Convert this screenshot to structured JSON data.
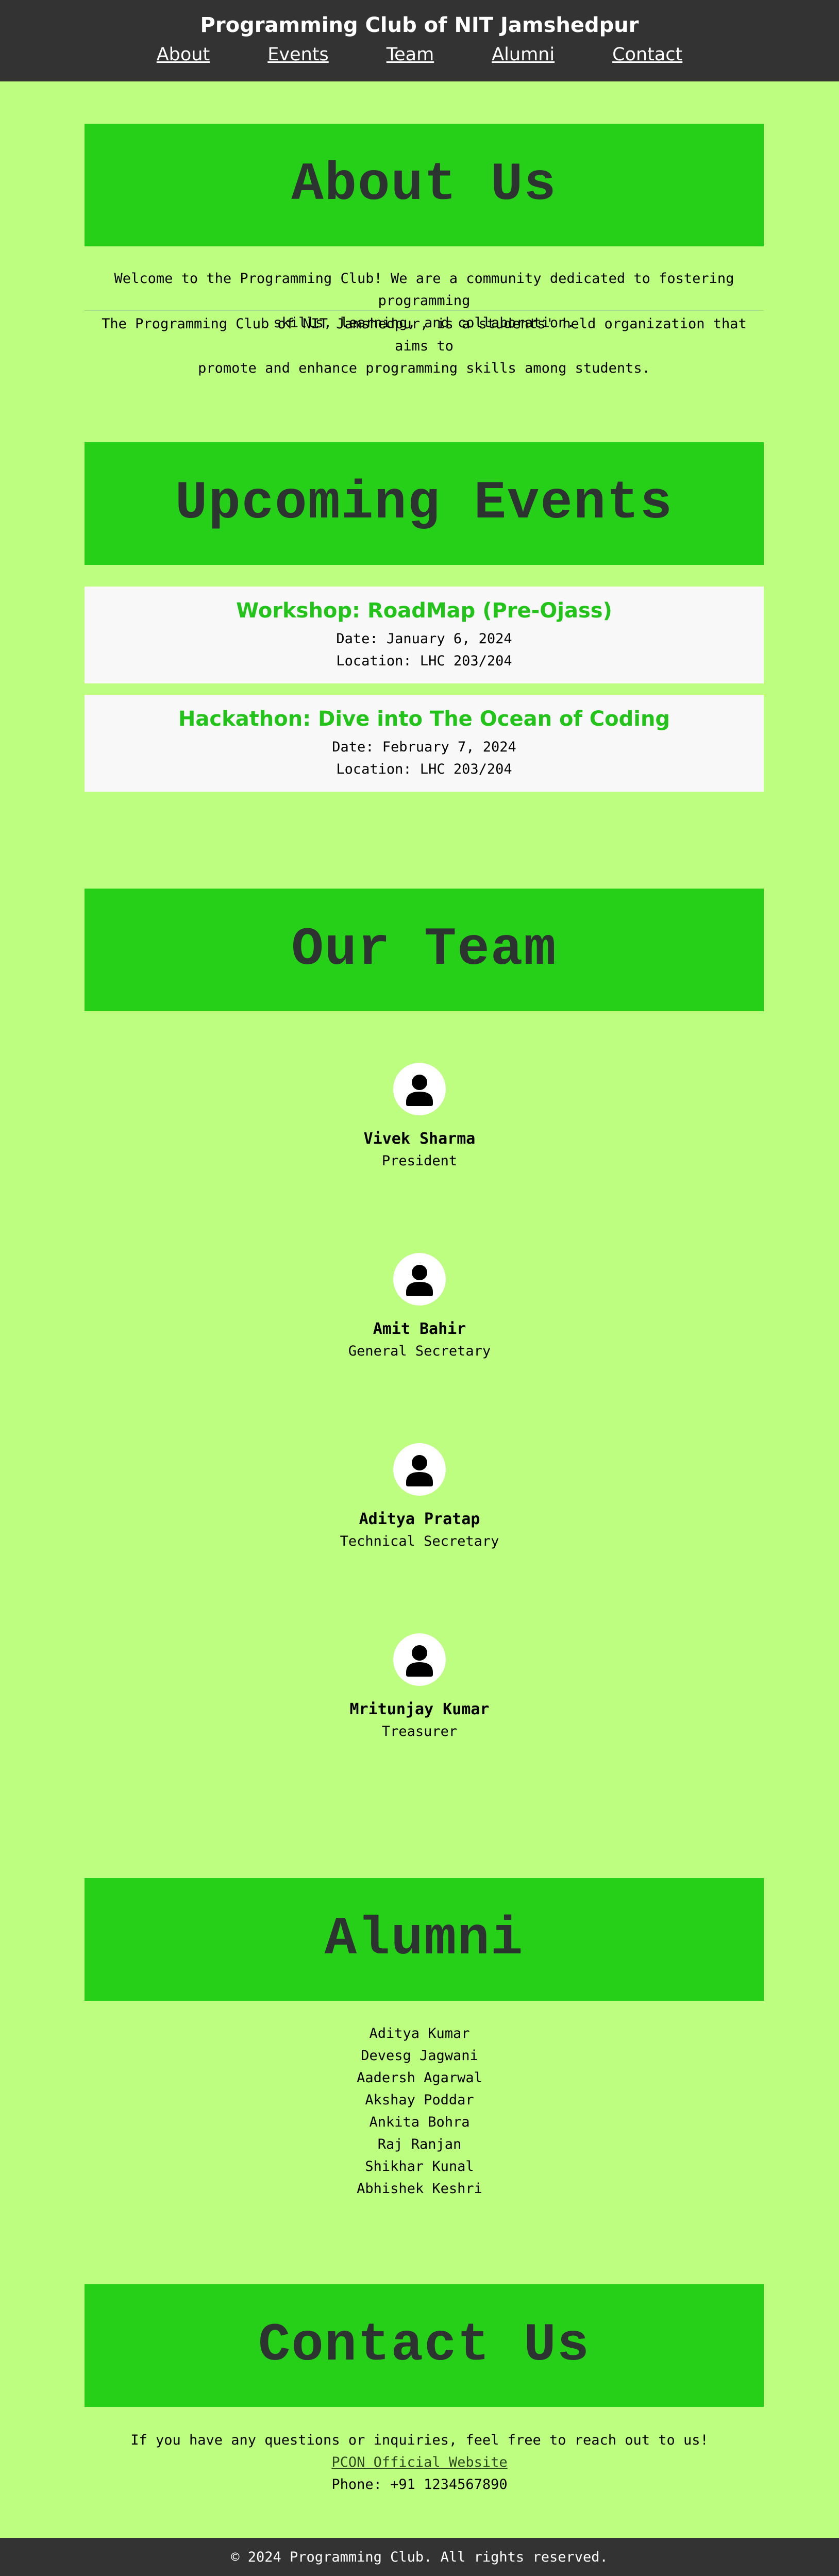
{
  "header": {
    "title": "Programming Club of NIT Jamshedpur",
    "nav": [
      "About",
      "Events",
      "Team",
      "Alumni",
      "Contact"
    ]
  },
  "about": {
    "heading": "About Us",
    "para1_line1": "Welcome to the Programming Club! We are a community dedicated to fostering programming",
    "para1_line2": "skills, learning, and collaboration.",
    "para2_line1": "The Programming Club of NIT Jamshedpur, is a students' held organization that aims to",
    "para2_line2": "promote and enhance programming skills among students."
  },
  "events": {
    "heading": "Upcoming Events",
    "items": [
      {
        "title": "Workshop: RoadMap (Pre-Ojass)",
        "date": "Date: January 6, 2024",
        "location": "Location: LHC 203/204"
      },
      {
        "title": "Hackathon: Dive into The Ocean of Coding",
        "date": "Date: February 7, 2024",
        "location": "Location: LHC 203/204"
      }
    ]
  },
  "team": {
    "heading": "Our Team",
    "members": [
      {
        "name": "Vivek Sharma",
        "role": "President"
      },
      {
        "name": "Amit Bahir",
        "role": "General Secretary"
      },
      {
        "name": "Aditya Pratap",
        "role": "Technical Secretary"
      },
      {
        "name": "Mritunjay Kumar",
        "role": "Treasurer"
      }
    ]
  },
  "alumni": {
    "heading": "Alumni",
    "names": [
      "Aditya Kumar",
      "Devesg Jagwani",
      "Aadersh Agarwal",
      "Akshay Poddar",
      "Ankita Bohra",
      "Raj Ranjan",
      "Shikhar Kunal",
      "Abhishek Keshri"
    ]
  },
  "contact": {
    "heading": "Contact Us",
    "intro": "If you have any questions or inquiries, feel free to reach out to us!",
    "link_label": "PCON Official Website",
    "phone": "Phone: +91 1234567890"
  },
  "footer": {
    "text": "© 2024 Programming Club. All rights reserved."
  },
  "colors": {
    "page_bg": "#bdfe81",
    "banner_bg": "#26cf18",
    "header_bg": "#333333",
    "event_title": "#22c41a"
  },
  "icons": {
    "avatar": "user-avatar-icon"
  }
}
